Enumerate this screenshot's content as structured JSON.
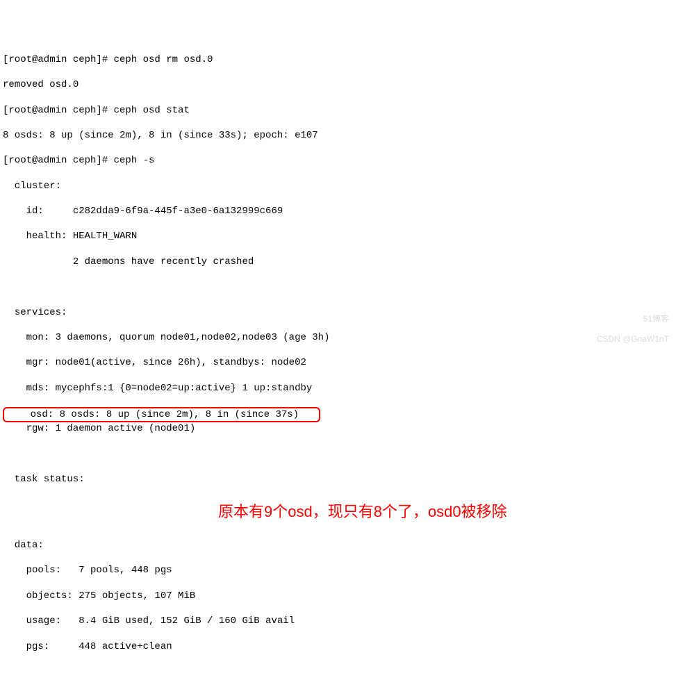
{
  "lines": {
    "l1": "[root@admin ceph]# ceph osd rm osd.0",
    "l2": "removed osd.0",
    "l3": "[root@admin ceph]# ceph osd stat",
    "l4": "8 osds: 8 up (since 2m), 8 in (since 33s); epoch: e107",
    "l5": "[root@admin ceph]# ceph -s",
    "l6": "  cluster:",
    "l7": "    id:     c282dda9-6f9a-445f-a3e0-6a132999c669",
    "l8": "    health: HEALTH_WARN",
    "l9": "            2 daemons have recently crashed",
    "l10": " ",
    "l11": "  services:",
    "l12": "    mon: 3 daemons, quorum node01,node02,node03 (age 3h)",
    "l13": "    mgr: node01(active, since 26h), standbys: node02",
    "l14": "    mds: mycephfs:1 {0=node02=up:active} 1 up:standby",
    "l15": "    osd: 8 osds: 8 up (since 2m), 8 in (since 37s)   ",
    "l16": "    rgw: 1 daemon active (node01)",
    "l17": " ",
    "l18": "  task status:",
    "l19": " ",
    "l20": "  data:",
    "l21": "    pools:   7 pools, 448 pgs",
    "l22": "    objects: 275 objects, 107 MiB",
    "l23": "    usage:   8.4 GiB used, 152 GiB / 160 GiB avail",
    "l24": "    pgs:     448 active+clean"
  },
  "annotation": "原本有9个osd，现只有8个了，osd0被移除",
  "watermark": {
    "line1": "51博客",
    "line2": "CSDN @GnaW1nT"
  }
}
